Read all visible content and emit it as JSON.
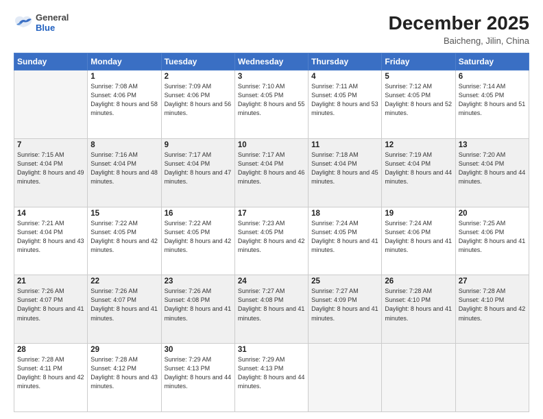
{
  "header": {
    "logo_general": "General",
    "logo_blue": "Blue",
    "month_title": "December 2025",
    "location": "Baicheng, Jilin, China"
  },
  "weekdays": [
    "Sunday",
    "Monday",
    "Tuesday",
    "Wednesday",
    "Thursday",
    "Friday",
    "Saturday"
  ],
  "weeks": [
    [
      {
        "day": "",
        "sunrise": "",
        "sunset": "",
        "daylight": ""
      },
      {
        "day": "1",
        "sunrise": "Sunrise: 7:08 AM",
        "sunset": "Sunset: 4:06 PM",
        "daylight": "Daylight: 8 hours and 58 minutes."
      },
      {
        "day": "2",
        "sunrise": "Sunrise: 7:09 AM",
        "sunset": "Sunset: 4:06 PM",
        "daylight": "Daylight: 8 hours and 56 minutes."
      },
      {
        "day": "3",
        "sunrise": "Sunrise: 7:10 AM",
        "sunset": "Sunset: 4:05 PM",
        "daylight": "Daylight: 8 hours and 55 minutes."
      },
      {
        "day": "4",
        "sunrise": "Sunrise: 7:11 AM",
        "sunset": "Sunset: 4:05 PM",
        "daylight": "Daylight: 8 hours and 53 minutes."
      },
      {
        "day": "5",
        "sunrise": "Sunrise: 7:12 AM",
        "sunset": "Sunset: 4:05 PM",
        "daylight": "Daylight: 8 hours and 52 minutes."
      },
      {
        "day": "6",
        "sunrise": "Sunrise: 7:14 AM",
        "sunset": "Sunset: 4:05 PM",
        "daylight": "Daylight: 8 hours and 51 minutes."
      }
    ],
    [
      {
        "day": "7",
        "sunrise": "Sunrise: 7:15 AM",
        "sunset": "Sunset: 4:04 PM",
        "daylight": "Daylight: 8 hours and 49 minutes."
      },
      {
        "day": "8",
        "sunrise": "Sunrise: 7:16 AM",
        "sunset": "Sunset: 4:04 PM",
        "daylight": "Daylight: 8 hours and 48 minutes."
      },
      {
        "day": "9",
        "sunrise": "Sunrise: 7:17 AM",
        "sunset": "Sunset: 4:04 PM",
        "daylight": "Daylight: 8 hours and 47 minutes."
      },
      {
        "day": "10",
        "sunrise": "Sunrise: 7:17 AM",
        "sunset": "Sunset: 4:04 PM",
        "daylight": "Daylight: 8 hours and 46 minutes."
      },
      {
        "day": "11",
        "sunrise": "Sunrise: 7:18 AM",
        "sunset": "Sunset: 4:04 PM",
        "daylight": "Daylight: 8 hours and 45 minutes."
      },
      {
        "day": "12",
        "sunrise": "Sunrise: 7:19 AM",
        "sunset": "Sunset: 4:04 PM",
        "daylight": "Daylight: 8 hours and 44 minutes."
      },
      {
        "day": "13",
        "sunrise": "Sunrise: 7:20 AM",
        "sunset": "Sunset: 4:04 PM",
        "daylight": "Daylight: 8 hours and 44 minutes."
      }
    ],
    [
      {
        "day": "14",
        "sunrise": "Sunrise: 7:21 AM",
        "sunset": "Sunset: 4:04 PM",
        "daylight": "Daylight: 8 hours and 43 minutes."
      },
      {
        "day": "15",
        "sunrise": "Sunrise: 7:22 AM",
        "sunset": "Sunset: 4:05 PM",
        "daylight": "Daylight: 8 hours and 42 minutes."
      },
      {
        "day": "16",
        "sunrise": "Sunrise: 7:22 AM",
        "sunset": "Sunset: 4:05 PM",
        "daylight": "Daylight: 8 hours and 42 minutes."
      },
      {
        "day": "17",
        "sunrise": "Sunrise: 7:23 AM",
        "sunset": "Sunset: 4:05 PM",
        "daylight": "Daylight: 8 hours and 42 minutes."
      },
      {
        "day": "18",
        "sunrise": "Sunrise: 7:24 AM",
        "sunset": "Sunset: 4:05 PM",
        "daylight": "Daylight: 8 hours and 41 minutes."
      },
      {
        "day": "19",
        "sunrise": "Sunrise: 7:24 AM",
        "sunset": "Sunset: 4:06 PM",
        "daylight": "Daylight: 8 hours and 41 minutes."
      },
      {
        "day": "20",
        "sunrise": "Sunrise: 7:25 AM",
        "sunset": "Sunset: 4:06 PM",
        "daylight": "Daylight: 8 hours and 41 minutes."
      }
    ],
    [
      {
        "day": "21",
        "sunrise": "Sunrise: 7:26 AM",
        "sunset": "Sunset: 4:07 PM",
        "daylight": "Daylight: 8 hours and 41 minutes."
      },
      {
        "day": "22",
        "sunrise": "Sunrise: 7:26 AM",
        "sunset": "Sunset: 4:07 PM",
        "daylight": "Daylight: 8 hours and 41 minutes."
      },
      {
        "day": "23",
        "sunrise": "Sunrise: 7:26 AM",
        "sunset": "Sunset: 4:08 PM",
        "daylight": "Daylight: 8 hours and 41 minutes."
      },
      {
        "day": "24",
        "sunrise": "Sunrise: 7:27 AM",
        "sunset": "Sunset: 4:08 PM",
        "daylight": "Daylight: 8 hours and 41 minutes."
      },
      {
        "day": "25",
        "sunrise": "Sunrise: 7:27 AM",
        "sunset": "Sunset: 4:09 PM",
        "daylight": "Daylight: 8 hours and 41 minutes."
      },
      {
        "day": "26",
        "sunrise": "Sunrise: 7:28 AM",
        "sunset": "Sunset: 4:10 PM",
        "daylight": "Daylight: 8 hours and 41 minutes."
      },
      {
        "day": "27",
        "sunrise": "Sunrise: 7:28 AM",
        "sunset": "Sunset: 4:10 PM",
        "daylight": "Daylight: 8 hours and 42 minutes."
      }
    ],
    [
      {
        "day": "28",
        "sunrise": "Sunrise: 7:28 AM",
        "sunset": "Sunset: 4:11 PM",
        "daylight": "Daylight: 8 hours and 42 minutes."
      },
      {
        "day": "29",
        "sunrise": "Sunrise: 7:28 AM",
        "sunset": "Sunset: 4:12 PM",
        "daylight": "Daylight: 8 hours and 43 minutes."
      },
      {
        "day": "30",
        "sunrise": "Sunrise: 7:29 AM",
        "sunset": "Sunset: 4:13 PM",
        "daylight": "Daylight: 8 hours and 44 minutes."
      },
      {
        "day": "31",
        "sunrise": "Sunrise: 7:29 AM",
        "sunset": "Sunset: 4:13 PM",
        "daylight": "Daylight: 8 hours and 44 minutes."
      },
      {
        "day": "",
        "sunrise": "",
        "sunset": "",
        "daylight": ""
      },
      {
        "day": "",
        "sunrise": "",
        "sunset": "",
        "daylight": ""
      },
      {
        "day": "",
        "sunrise": "",
        "sunset": "",
        "daylight": ""
      }
    ]
  ]
}
